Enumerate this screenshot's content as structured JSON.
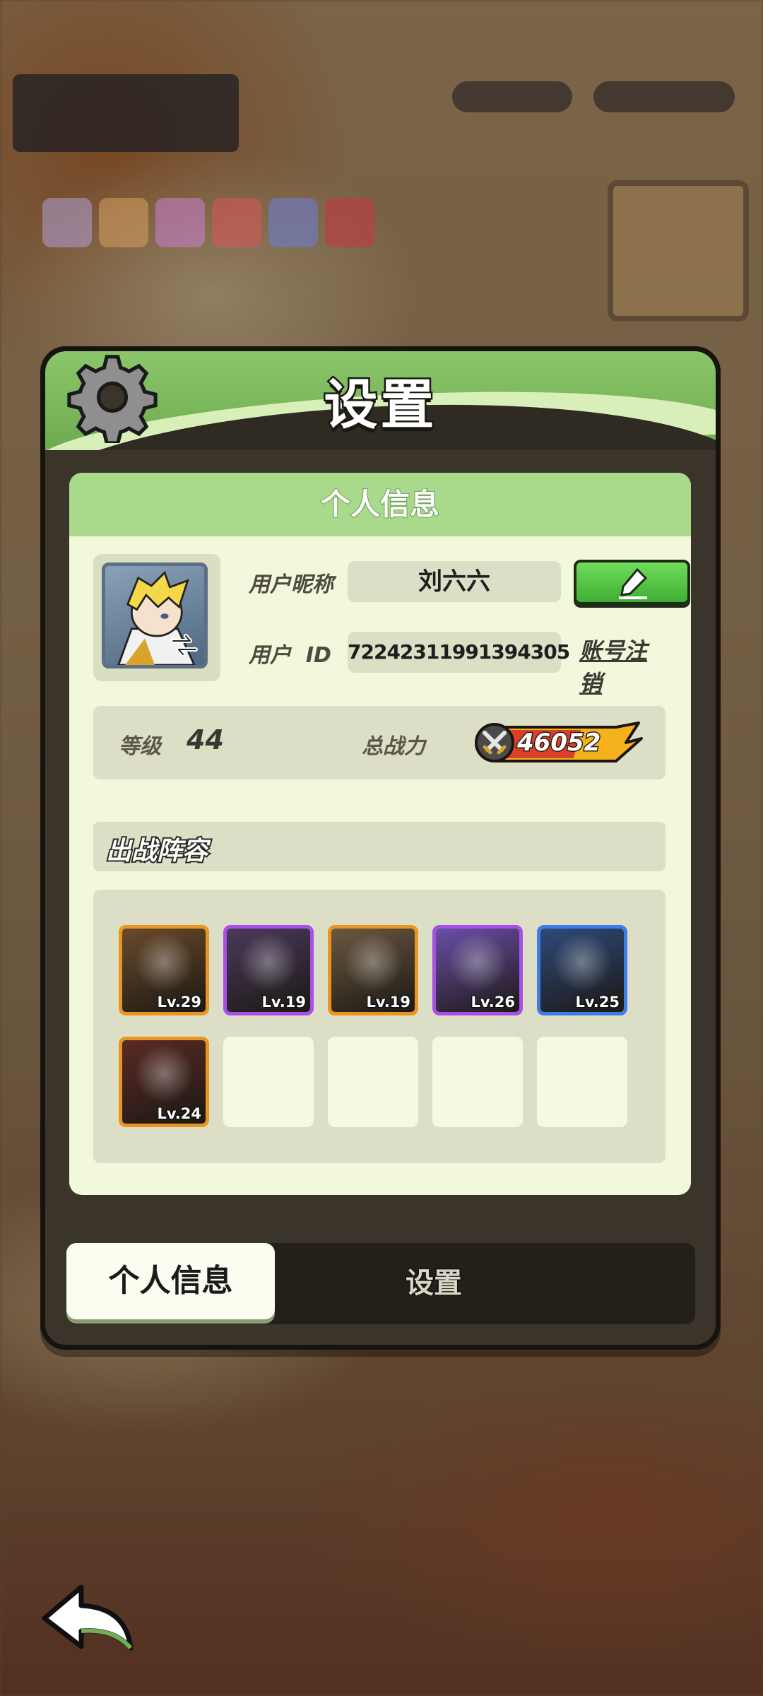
{
  "dialog": {
    "title": "设置"
  },
  "panel": {
    "header": "个人信息",
    "nickname_label": "用户昵称",
    "nickname_value": "刘六六",
    "uid_label": "用户  ID",
    "uid_value": "72242311991394305",
    "account_cancel_label": "账号注销",
    "level_label": "等级",
    "level_value": "44",
    "power_label": "总战力",
    "power_value": "46052",
    "lineup_title": "出战阵容"
  },
  "lineup": [
    {
      "level": "Lv.29",
      "rarity": "orange",
      "frame_color": "#e8961f",
      "bg": "#6a4a2a"
    },
    {
      "level": "Lv.19",
      "rarity": "purple",
      "frame_color": "#a650e8",
      "bg": "#4a3a5a"
    },
    {
      "level": "Lv.19",
      "rarity": "orange",
      "frame_color": "#e8961f",
      "bg": "#6a5840"
    },
    {
      "level": "Lv.26",
      "rarity": "purple",
      "frame_color": "#a650e8",
      "bg": "#6a4fa8"
    },
    {
      "level": "Lv.25",
      "rarity": "blue",
      "frame_color": "#3d7ee6",
      "bg": "#2e4a7a"
    },
    {
      "level": "Lv.24",
      "rarity": "orange",
      "frame_color": "#e8961f",
      "bg": "#5a2a24"
    }
  ],
  "tabs": [
    {
      "label": "个人信息",
      "active": true
    },
    {
      "label": "设置",
      "active": false
    }
  ],
  "colors": {
    "header_green": "#8bc66a",
    "panel_bg": "#f2f8dc",
    "edit_green": "#3fae34",
    "power_flame": "#f5b21c"
  },
  "icons": {
    "settings": "gear-icon",
    "edit": "pen-icon",
    "swap": "swap-icon",
    "power": "crossed-swords-icon",
    "back": "back-arrow-icon"
  }
}
